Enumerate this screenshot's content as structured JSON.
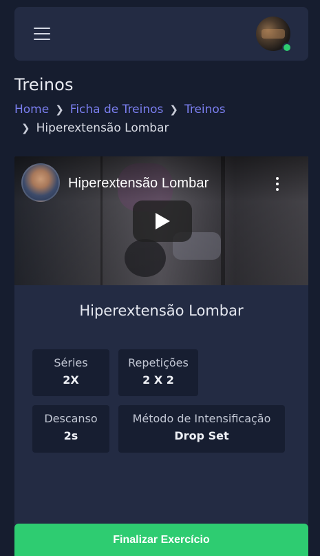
{
  "header": {
    "menu_icon": "hamburger-menu-icon",
    "avatar_status": "online",
    "status_color": "#2ecc71"
  },
  "page": {
    "title": "Treinos"
  },
  "breadcrumb": {
    "items": [
      "Home",
      "Ficha de Treinos",
      "Treinos"
    ],
    "current": "Hiperextensão Lombar",
    "separator_icon": "chevron-right-icon"
  },
  "video": {
    "title": "Hiperextensão Lombar",
    "play_icon": "play-icon",
    "menu_icon": "more-vertical-icon"
  },
  "exercise": {
    "name": "Hiperextensão Lombar",
    "stats": {
      "series": {
        "label": "Séries",
        "value": "2X"
      },
      "reps": {
        "label": "Repetições",
        "value": "2 X 2"
      },
      "rest": {
        "label": "Descanso",
        "value": "2s"
      },
      "method": {
        "label": "Método de Intensificação",
        "value": "Drop Set"
      }
    }
  },
  "actions": {
    "finish_label": "Finalizar Exercício",
    "finish_color": "#2ecc71"
  },
  "colors": {
    "background": "#161d2f",
    "card": "#232b43",
    "link": "#7b7ff0"
  }
}
